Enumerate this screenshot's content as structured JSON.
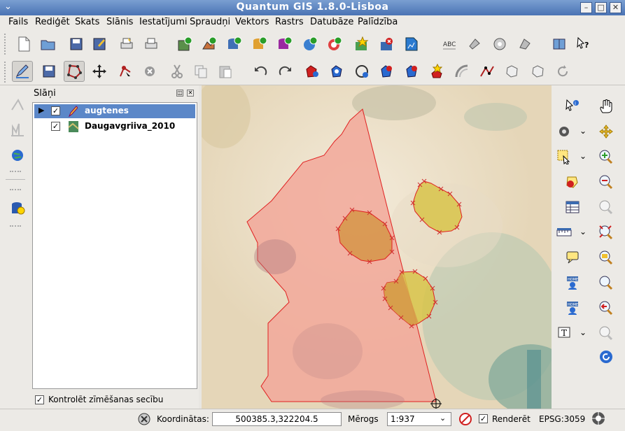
{
  "window": {
    "title": "Quantum GIS 1.8.0-Lisboa",
    "menu_glyph": "⌄",
    "min_glyph": "–",
    "max_glyph": "□",
    "close_glyph": "✕"
  },
  "menubar": {
    "items": [
      "Fails",
      "Rediģēt",
      "Skats",
      "Slānis",
      "Iestatījumi",
      "Spraudņi",
      "Vektors",
      "Rastrs",
      "Datubāze",
      "Palīdzība"
    ]
  },
  "toolbar1_icons": [
    "new-project",
    "open-project",
    "save-project",
    "save-as",
    "print-composer",
    "print",
    "add-raster",
    "add-vector",
    "add-postgis",
    "add-spatialite",
    "add-mssql",
    "add-wms",
    "add-wfs",
    "new-layer",
    "remove-layer",
    "gps",
    "spell-check",
    "plugins",
    "plugin-config",
    "settings",
    "help",
    "whats-this"
  ],
  "toolbar2_icons": [
    "toggle-editing",
    "save-edits",
    "capture-polygon",
    "move-feature",
    "node-tool",
    "delete-selected",
    "cut",
    "copy",
    "paste",
    "undo",
    "redo",
    "simplify",
    "add-ring",
    "add-part",
    "delete-ring",
    "delete-part",
    "reshape",
    "offset",
    "split",
    "merge",
    "rotate"
  ],
  "layers_panel": {
    "title": "Slāņi",
    "layers": [
      {
        "name": "augtenes",
        "checked": true,
        "selected": true
      },
      {
        "name": "Daugavgriiva_2010",
        "checked": true,
        "selected": false
      }
    ],
    "render_order_checkbox": "Kontrolēt zīmēšanas secību"
  },
  "status": {
    "coords_label": "Koordinātas:",
    "coords_value": "500385.3,322204.5",
    "scale_label": "Mērogs",
    "scale_value": "1:937",
    "render_label": "Renderēt",
    "epsg": "EPSG:3059"
  },
  "colors": {
    "polygon_fill": "#f2a89a",
    "polygon_stroke": "#e02020",
    "yellow_poly": "#d8c44a",
    "orange_poly": "#d69548",
    "vertex": "#d23030"
  }
}
